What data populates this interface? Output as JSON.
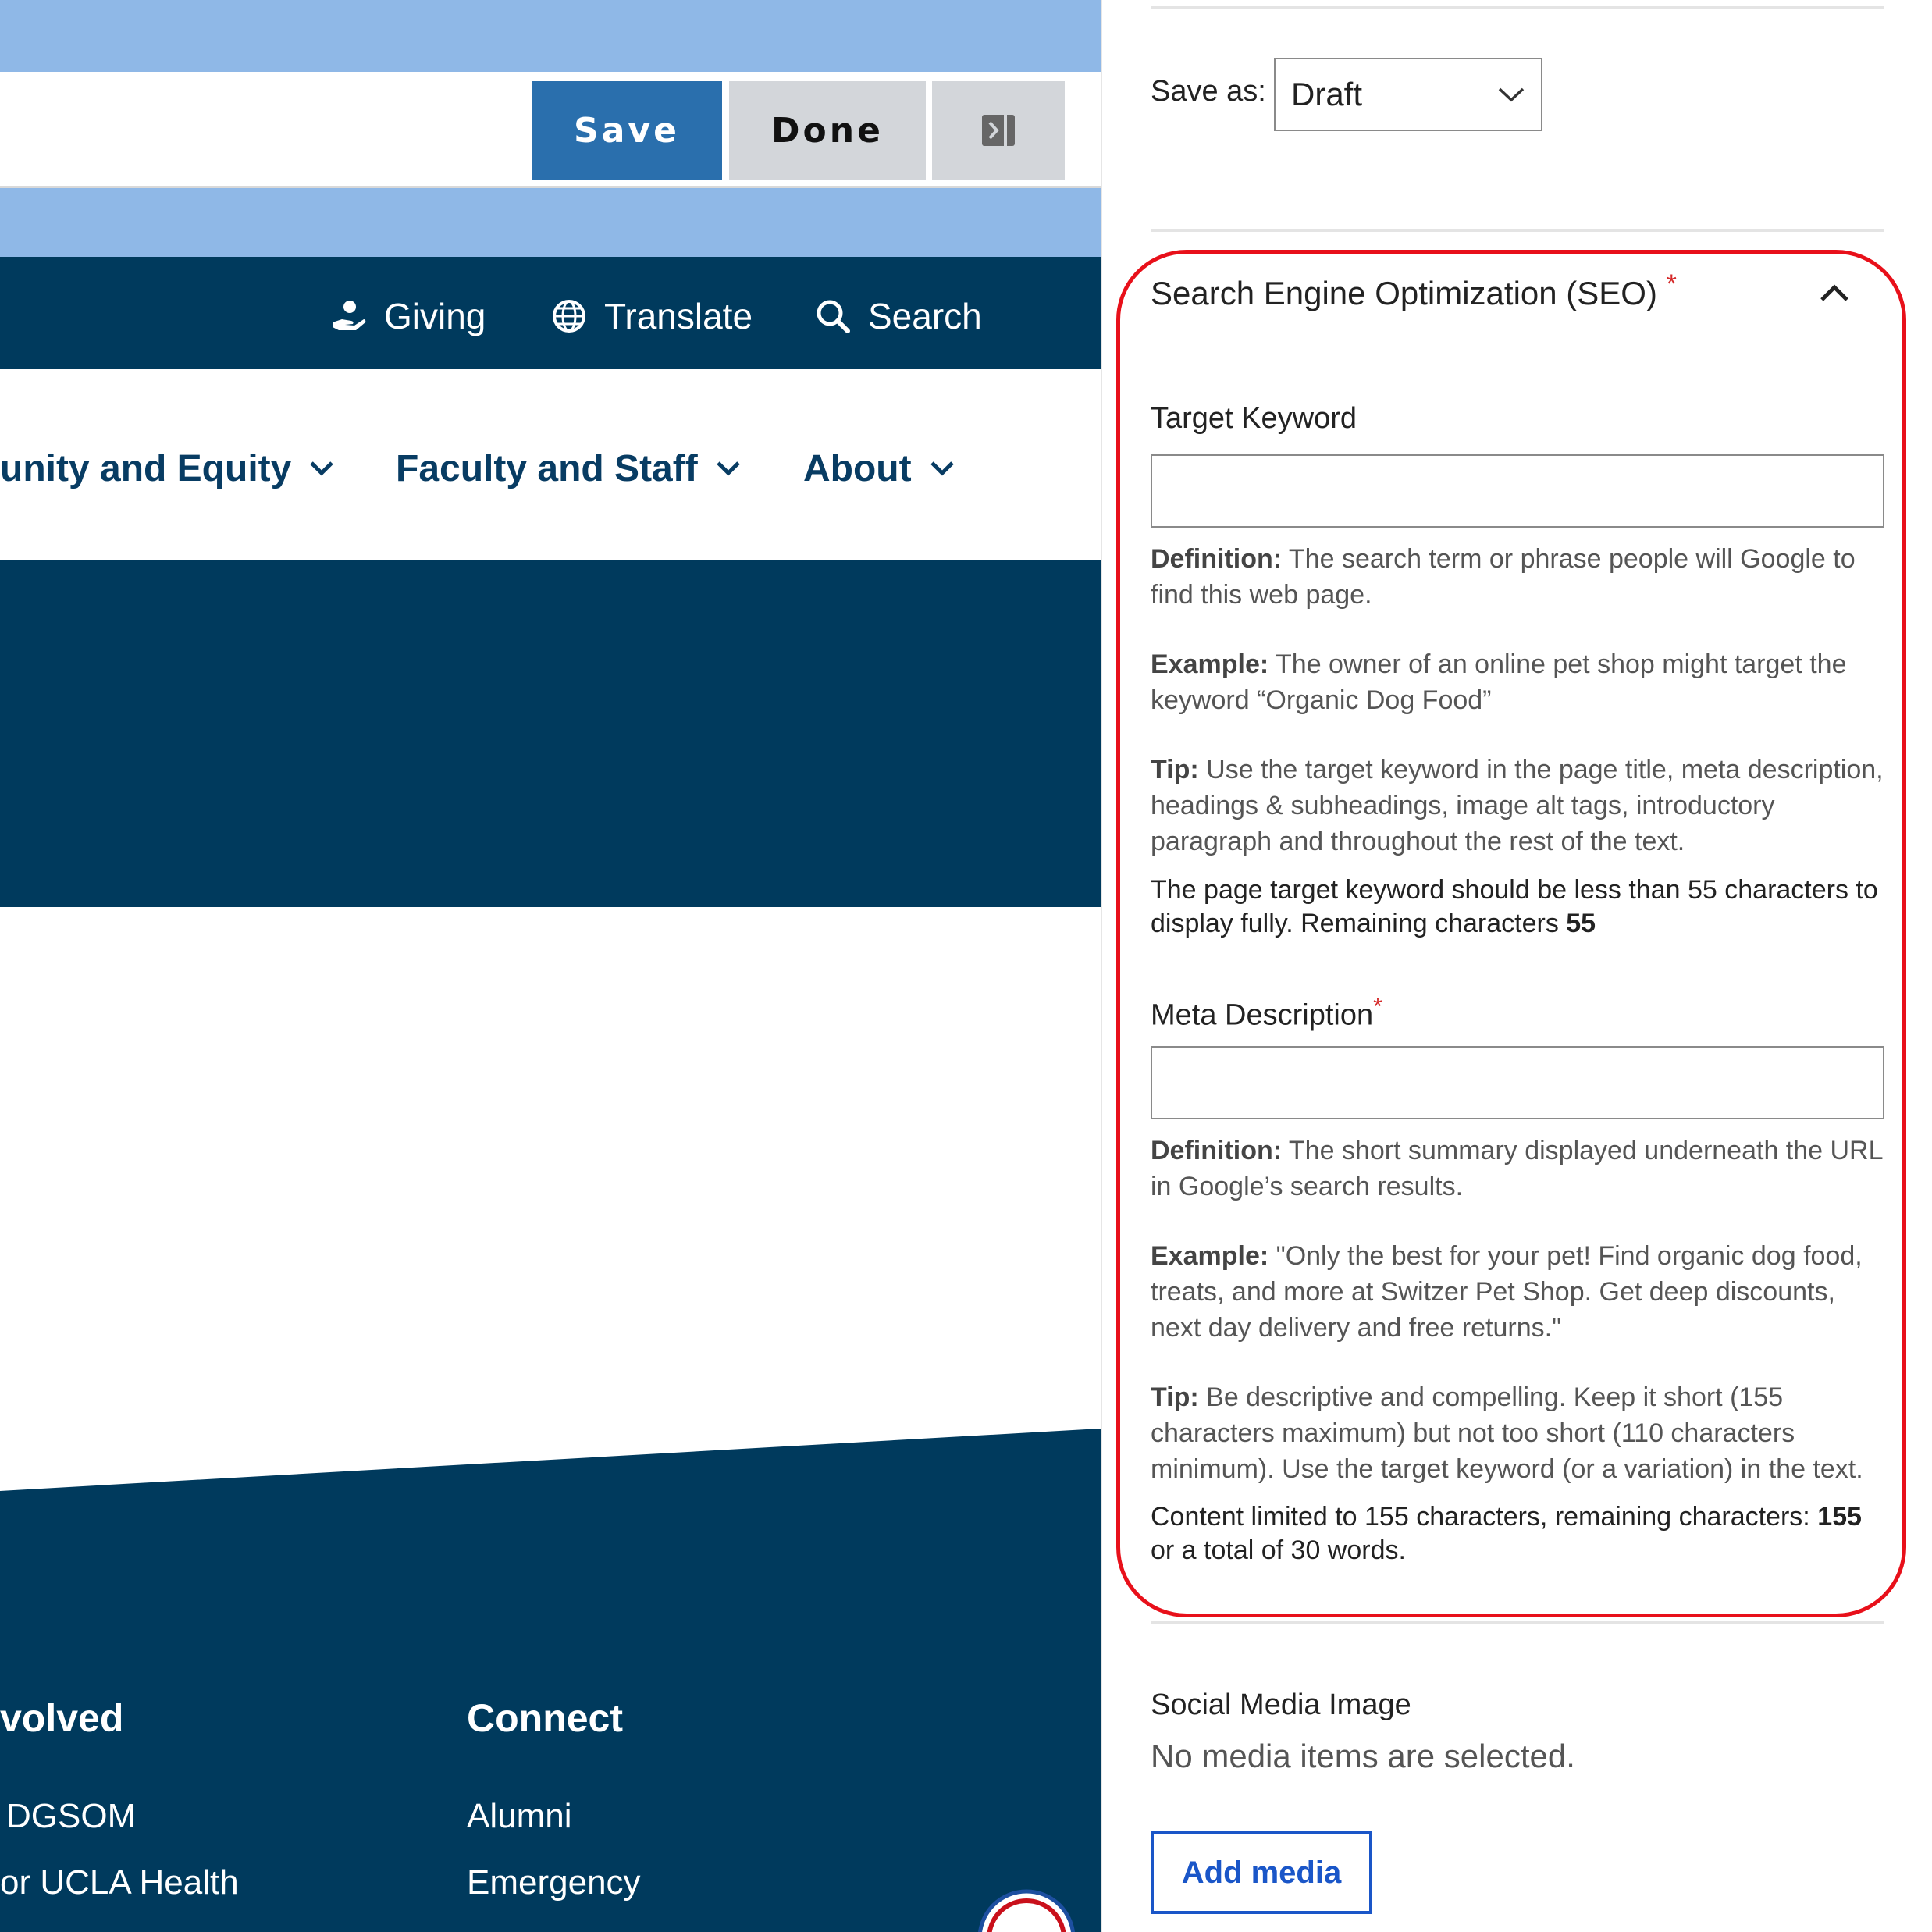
{
  "toolbar": {
    "save_label": "Save",
    "done_label": "Done"
  },
  "utility_nav": [
    {
      "label": "Giving",
      "icon": "giving-hand-icon"
    },
    {
      "label": "Translate",
      "icon": "globe-icon"
    },
    {
      "label": "Search",
      "icon": "search-icon"
    }
  ],
  "main_nav": [
    {
      "label": "unity and Equity"
    },
    {
      "label": "Faculty and Staff"
    },
    {
      "label": "About"
    }
  ],
  "footer": {
    "col1": {
      "heading": "volved",
      "links": [
        "DGSOM",
        "or UCLA Health"
      ]
    },
    "col2": {
      "heading": "Connect",
      "links": [
        "Alumni",
        "Emergency"
      ]
    }
  },
  "sidebar": {
    "save_as_label": "Save as:",
    "save_as_value": "Draft",
    "seo": {
      "title": "Search Engine Optimization (SEO)",
      "required_mark": "*",
      "target_keyword": {
        "label": "Target Keyword",
        "value": "",
        "definition_label": "Definition:",
        "definition_text": " The search term or phrase people will Google to find this web page.",
        "example_label": "Example:",
        "example_text": " The owner of an online pet shop might target the keyword “Organic Dog Food”",
        "tip_label": "Tip:",
        "tip_text": " Use the target keyword in the page title, meta description, headings & subheadings, image alt tags, introductory paragraph and throughout the rest of the text.",
        "count_text": "The page target keyword should be less than 55 characters to display fully. Remaining characters ",
        "count_value": "55"
      },
      "meta_description": {
        "label": "Meta Description",
        "required_mark": "*",
        "value": "",
        "definition_label": "Definition:",
        "definition_text": " The short summary displayed underneath the URL in Google’s search results.",
        "example_label": "Example:",
        "example_text": " \"Only the best for your pet! Find organic dog food, treats, and more at Switzer Pet Shop. Get deep discounts, next day delivery and free returns.\"",
        "tip_label": "Tip:",
        "tip_text": " Be descriptive and compelling. Keep it short (155 characters maximum) but not too short (110 characters minimum). Use the target keyword (or a variation) in the text.",
        "count_text_1": "Content limited to 155 characters, remaining characters: ",
        "count_value": "155",
        "count_text_2": "or a total of 30 words."
      }
    },
    "social": {
      "label": "Social Media Image",
      "empty_text": "No media items are selected.",
      "add_button": "Add media"
    }
  },
  "colors": {
    "light_band": "#8fb8e7",
    "navy": "#003a5d",
    "save_button": "#2a6fad",
    "highlight_ring": "#e8101a",
    "add_media_border": "#1a56c8"
  }
}
